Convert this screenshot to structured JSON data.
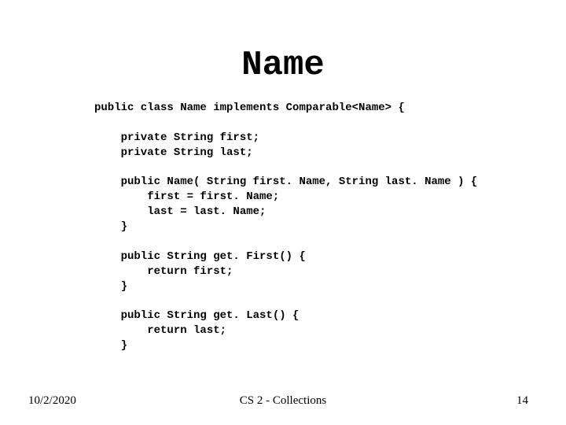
{
  "title": "Name",
  "code": "public class Name implements Comparable<Name> {\n\n    private String first;\n    private String last;\n\n    public Name( String first. Name, String last. Name ) {\n        first = first. Name;\n        last = last. Name;\n    }\n\n    public String get. First() {\n        return first;\n    }\n\n    public String get. Last() {\n        return last;\n    }",
  "footer": {
    "date": "10/2/2020",
    "center": "CS 2 - Collections",
    "page": "14"
  }
}
